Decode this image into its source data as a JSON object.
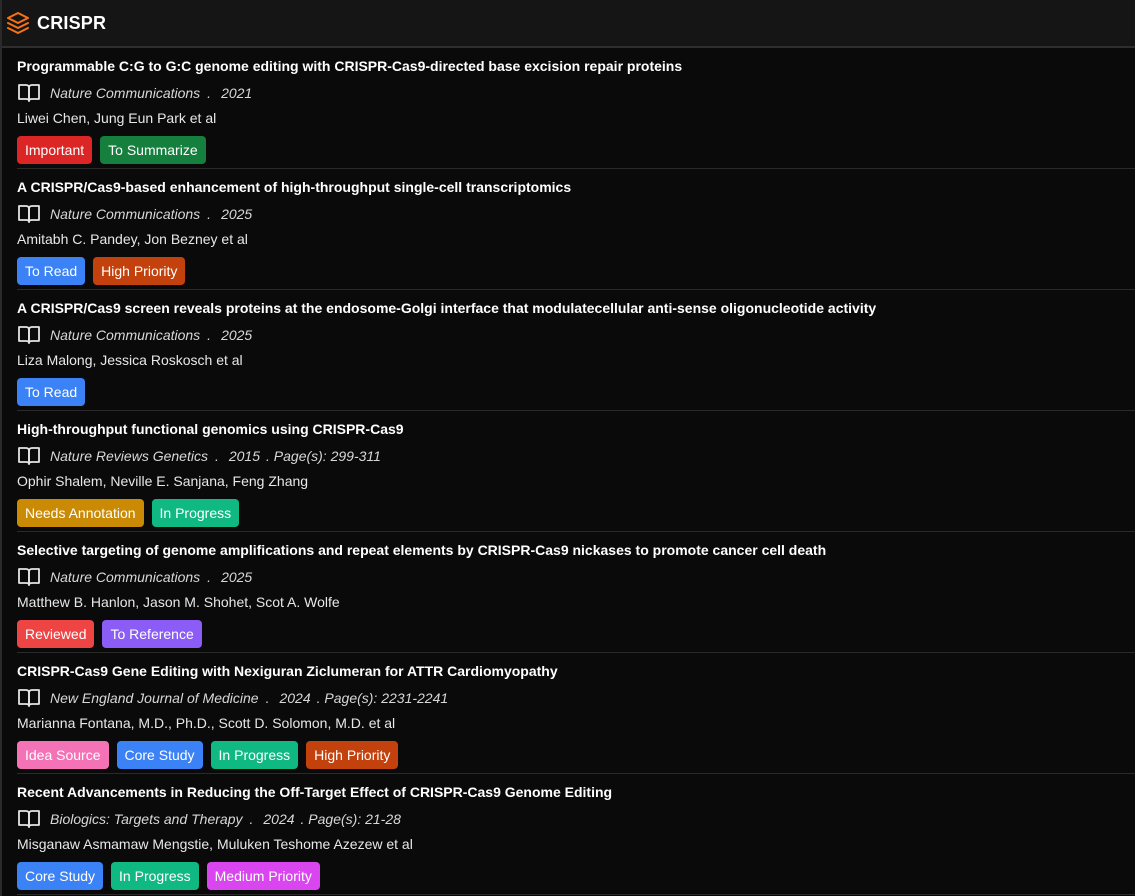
{
  "app": {
    "title": "CRISPR",
    "accent": "#f97316"
  },
  "tag_colors": {
    "Important": "#dc2626",
    "To Summarize": "#15803d",
    "To Read": "#3b82f6",
    "High Priority": "#c2410c",
    "Needs Annotation": "#ca8a04",
    "In Progress": "#10b981",
    "Reviewed": "#ef4444",
    "To Reference": "#8b5cf6",
    "Idea Source": "#f472b6",
    "Core Study": "#3b82f6",
    "Medium Priority": "#d946ef"
  },
  "papers": [
    {
      "title": "Programmable C:G to G:C genome editing with CRISPR-Cas9-directed base excision repair proteins",
      "journal": "Nature Communications",
      "year": "2021",
      "pages": "",
      "authors": "Liwei Chen, Jung Eun Park et al",
      "tags": [
        "Important",
        "To Summarize"
      ]
    },
    {
      "title": "A CRISPR/Cas9-based enhancement of high-throughput single-cell transcriptomics",
      "journal": "Nature Communications",
      "year": "2025",
      "pages": "",
      "authors": "Amitabh C. Pandey, Jon Bezney et al",
      "tags": [
        "To Read",
        "High Priority"
      ]
    },
    {
      "title": "A CRISPR/Cas9 screen reveals proteins at the endosome-Golgi interface that modulatecellular anti-sense oligonucleotide activity",
      "journal": "Nature Communications",
      "year": "2025",
      "pages": "",
      "authors": "Liza Malong, Jessica Roskosch et al",
      "tags": [
        "To Read"
      ]
    },
    {
      "title": "High-throughput functional genomics using CRISPR-Cas9",
      "journal": "Nature Reviews Genetics",
      "year": "2015",
      "pages": ". Page(s): 299-311",
      "authors": "Ophir Shalem, Neville E. Sanjana, Feng Zhang",
      "tags": [
        "Needs Annotation",
        "In Progress"
      ]
    },
    {
      "title": "Selective targeting of genome amplifications and repeat elements by CRISPR-Cas9 nickases to promote cancer cell death",
      "journal": "Nature Communications",
      "year": "2025",
      "pages": "",
      "authors": "Matthew B. Hanlon, Jason M. Shohet, Scot A. Wolfe",
      "tags": [
        "Reviewed",
        "To Reference"
      ]
    },
    {
      "title": "CRISPR-Cas9 Gene Editing with Nexiguran Ziclumeran for ATTR Cardiomyopathy",
      "journal": "New England Journal of Medicine",
      "year": "2024",
      "pages": ". Page(s): 2231-2241",
      "authors": "Marianna Fontana, M.D., Ph.D., Scott D. Solomon, M.D. et al",
      "tags": [
        "Idea Source",
        "Core Study",
        "In Progress",
        "High Priority"
      ]
    },
    {
      "title": "Recent Advancements in Reducing the Off-Target Effect of CRISPR-Cas9 Genome Editing",
      "journal": "Biologics: Targets and Therapy",
      "year": "2024",
      "pages": ". Page(s): 21-28",
      "authors": "Misganaw Asmamaw Mengstie, Muluken Teshome Azezew et al",
      "tags": [
        "Core Study",
        "In Progress",
        "Medium Priority"
      ]
    }
  ],
  "separator": "."
}
